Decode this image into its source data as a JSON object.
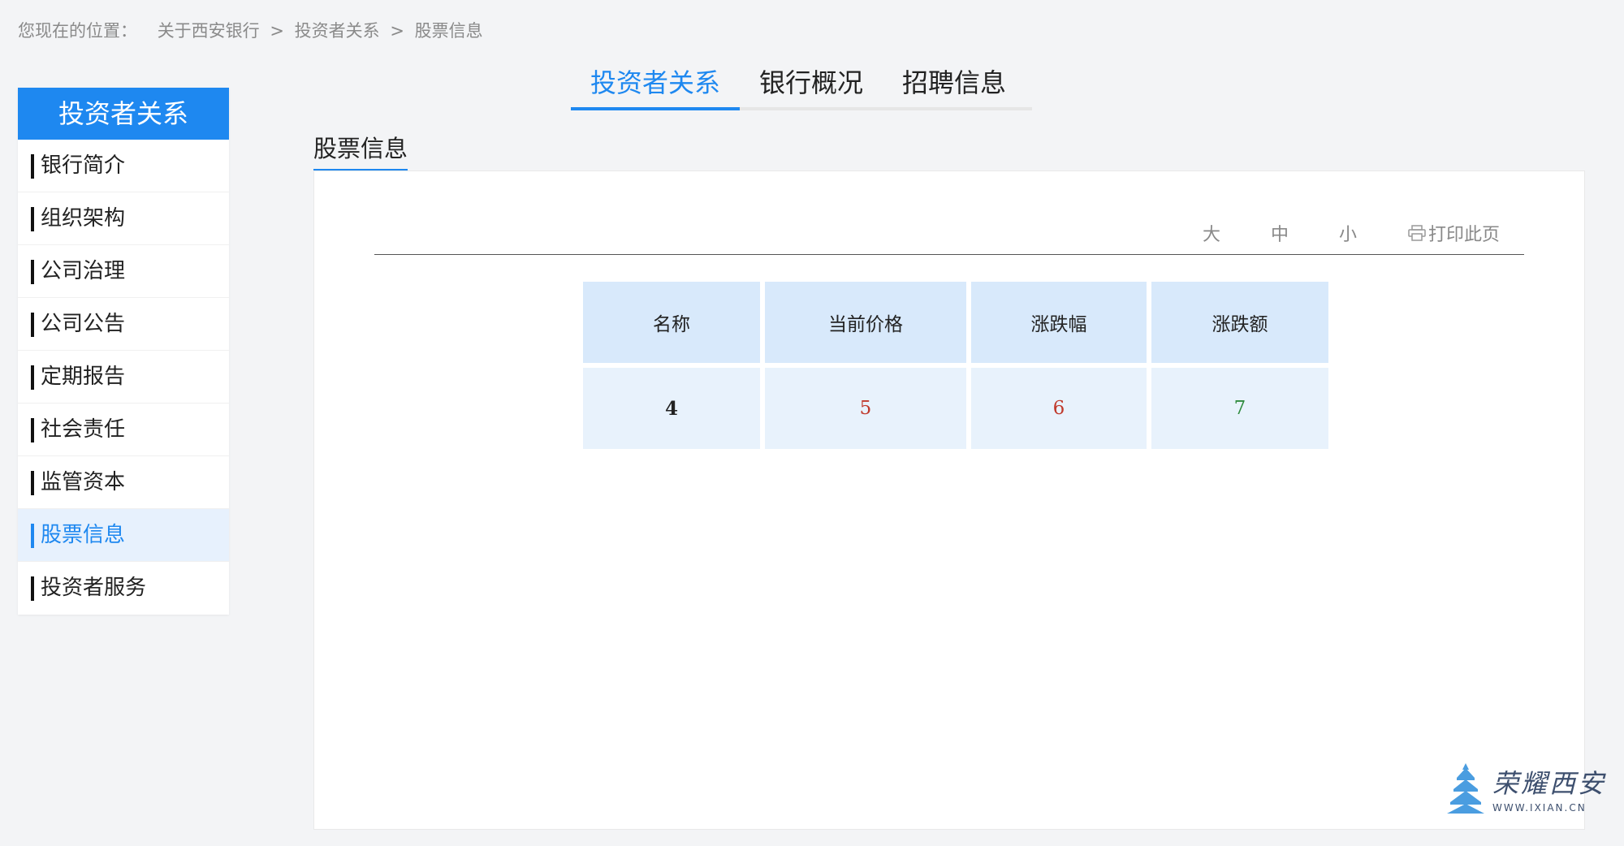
{
  "breadcrumb": {
    "prefix": "您现在的位置：",
    "items": [
      "关于西安银行",
      "投资者关系",
      "股票信息"
    ],
    "separator": ">"
  },
  "sidebar": {
    "header": "投资者关系",
    "items": [
      {
        "label": "银行简介"
      },
      {
        "label": "组织架构"
      },
      {
        "label": "公司治理"
      },
      {
        "label": "公司公告"
      },
      {
        "label": "定期报告"
      },
      {
        "label": "社会责任"
      },
      {
        "label": "监管资本"
      },
      {
        "label": "股票信息",
        "active": true
      },
      {
        "label": "投资者服务"
      }
    ]
  },
  "top_tabs": [
    {
      "label": "投资者关系",
      "active": true
    },
    {
      "label": "银行概况"
    },
    {
      "label": "招聘信息"
    }
  ],
  "section": {
    "title": "股票信息"
  },
  "toolbar": {
    "font_large": "大",
    "font_medium": "中",
    "font_small": "小",
    "print": "打印此页"
  },
  "stock_table": {
    "headers": [
      "名称",
      "当前价格",
      "涨跌幅",
      "涨跌额"
    ],
    "row": [
      "4",
      "5",
      "6",
      "7"
    ]
  },
  "watermark": {
    "title": "荣耀西安",
    "subtitle": "WWW.IXIAN.CN"
  },
  "colors": {
    "accent": "#1e88f0",
    "up": "#c0392b",
    "down": "#2e8b3d"
  }
}
